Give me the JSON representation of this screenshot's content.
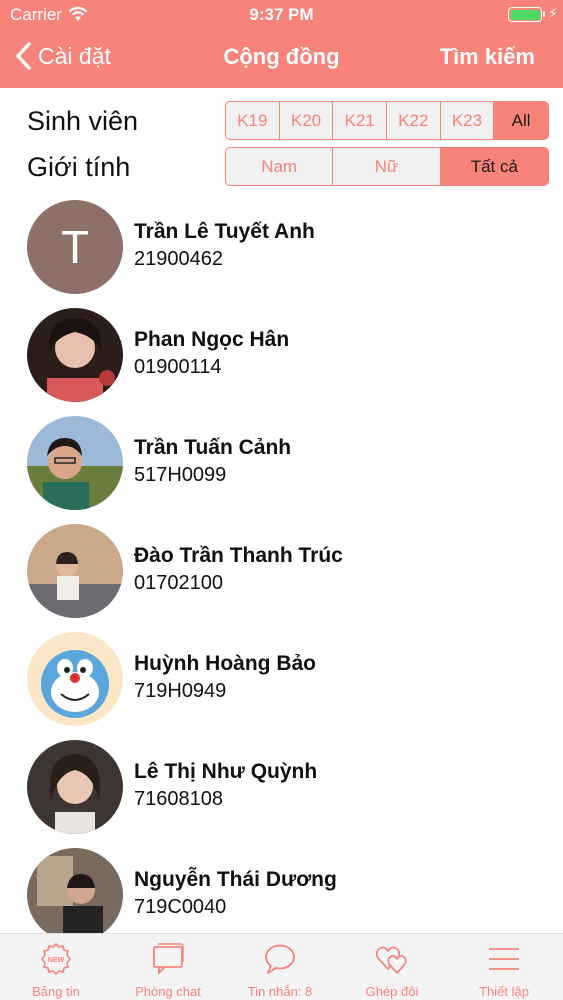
{
  "status": {
    "carrier": "Carrier",
    "time": "9:37 PM"
  },
  "nav": {
    "back_label": "Cài đặt",
    "title": "Cộng đồng",
    "right_label": "Tìm kiếm"
  },
  "filters": {
    "class_label": "Sinh viên",
    "class_options": [
      "K19",
      "K20",
      "K21",
      "K22",
      "K23",
      "All"
    ],
    "class_selected": "All",
    "gender_label": "Giới tính",
    "gender_options": [
      "Nam",
      "Nữ",
      "Tất cả"
    ],
    "gender_selected": "Tất cả"
  },
  "members": [
    {
      "name": "Trần Lê Tuyết Anh",
      "id": "21900462",
      "avatar_letter": "T"
    },
    {
      "name": "Phan Ngọc Hân",
      "id": "01900114"
    },
    {
      "name": "Trần Tuấn Cảnh",
      "id": "517H0099"
    },
    {
      "name": "Đào Trần Thanh Trúc",
      "id": "01702100"
    },
    {
      "name": "Huỳnh Hoàng Bảo",
      "id": "719H0949"
    },
    {
      "name": "Lê Thị Như Quỳnh",
      "id": "71608108"
    },
    {
      "name": "Nguyễn Thái Dương",
      "id": "719C0040"
    }
  ],
  "tabs": [
    {
      "label": "Bảng tin",
      "icon": "news-icon",
      "badge": "NEW"
    },
    {
      "label": "Phòng chat",
      "icon": "chat-room-icon"
    },
    {
      "label": "Tin nhắn: 8",
      "icon": "message-bubble-icon"
    },
    {
      "label": "Ghép đôi",
      "icon": "hearts-icon"
    },
    {
      "label": "Thiết lập",
      "icon": "menu-icon"
    }
  ],
  "colors": {
    "accent": "#f7837a",
    "battery": "#4cd964",
    "tabbar": "#f4f4f4"
  }
}
